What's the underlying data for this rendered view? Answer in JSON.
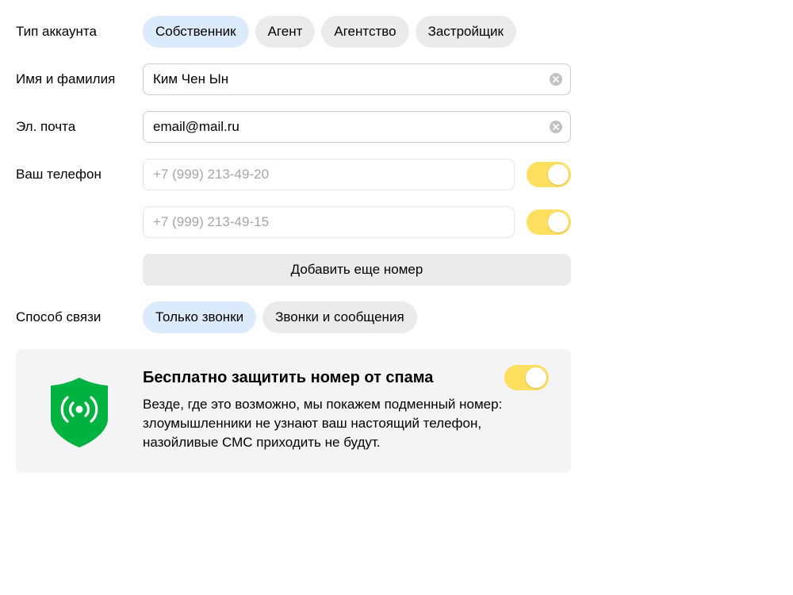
{
  "account_type": {
    "label": "Тип аккаунта",
    "options": [
      {
        "label": "Собственник",
        "selected": true
      },
      {
        "label": "Агент",
        "selected": false
      },
      {
        "label": "Агентство",
        "selected": false
      },
      {
        "label": "Застройщик",
        "selected": false
      }
    ]
  },
  "name_field": {
    "label": "Имя и фамилия",
    "value": "Ким Чен Ын"
  },
  "email_field": {
    "label": "Эл. почта",
    "value": "email@mail.ru"
  },
  "phone": {
    "label": "Ваш телефон",
    "numbers": [
      {
        "placeholder": "+7 (999) 213-49-20",
        "enabled": true
      },
      {
        "placeholder": "+7 (999) 213-49-15",
        "enabled": true
      }
    ],
    "add_label": "Добавить еще номер"
  },
  "contact_method": {
    "label": "Способ связи",
    "options": [
      {
        "label": "Только звонки",
        "selected": true
      },
      {
        "label": "Звонки и сообщения",
        "selected": false
      }
    ]
  },
  "spam_protection": {
    "title": "Бесплатно защитить номер от спама",
    "description": "Везде, где это возможно, мы покажем подменный номер: злоумышленники не узнают ваш настоящий телефон, назойливые СМС приходить не будут.",
    "enabled": true,
    "icon": "shield-signal-icon"
  },
  "colors": {
    "chip_selected": "#dcebfb",
    "chip_default": "#ebebeb",
    "toggle_on": "#ffdf5f",
    "shield_green": "#00b341",
    "card_background": "#f4f4f4"
  }
}
